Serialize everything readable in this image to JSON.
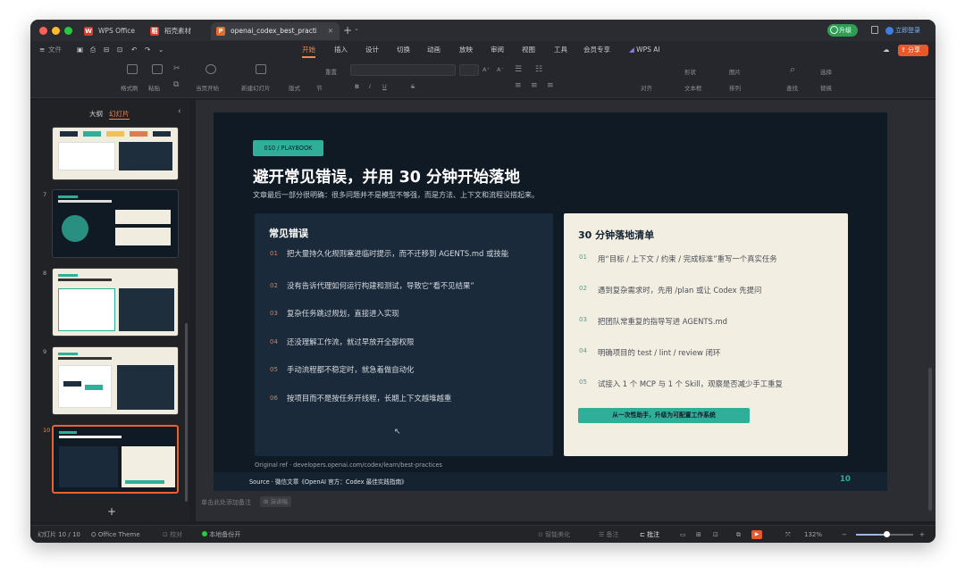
{
  "window": {
    "tabs": [
      {
        "label": "WPS Office",
        "icon": "wps-icon"
      },
      {
        "label": "稻壳素材",
        "icon": "docer-icon"
      },
      {
        "label": "openai_codex_best_practic",
        "icon": "ppt-file-icon"
      }
    ],
    "new_tab": "+",
    "upgrade_label": "升级",
    "login_label": "立即登录"
  },
  "menubar": {
    "file_label": "文件",
    "menus": [
      "开始",
      "插入",
      "设计",
      "切换",
      "动画",
      "放映",
      "审阅",
      "视图",
      "工具",
      "会员专享",
      "WPS AI"
    ],
    "active_menu": "开始",
    "share_label": "分享"
  },
  "toolbar": {
    "format_painter": "格式刷",
    "paste": "粘贴",
    "from_start": "当页开始",
    "new_slide": "新建幻灯片",
    "layout": "版式",
    "section": "节",
    "reset": "重置",
    "font_size_up": "A⁺",
    "font_size_down": "A⁻",
    "bold": "B",
    "italic": "I",
    "underline": "U",
    "strike": "S",
    "align": "对齐",
    "shape": "形状",
    "picture": "图片",
    "textbox": "文本框",
    "arrange": "排列",
    "find": "查找",
    "select": "选择",
    "replace": "替换"
  },
  "left_panel": {
    "tab_outline": "大纲",
    "tab_slides": "幻灯片",
    "slide_numbers": [
      "7",
      "8",
      "9",
      "10"
    ],
    "add_slide": "+"
  },
  "slide": {
    "tag": "010 / PLAYBOOK",
    "title": "避开常见错误，并用 30 分钟开始落地",
    "subtitle": "文章最后一部分很明确：很多问题并不是模型不够强，而是方法、上下文和流程没搭起来。",
    "errors_title": "常见错误",
    "errors": [
      {
        "num": "01",
        "text": "把大量持久化规则塞进临时提示，而不迁移到 AGENTS.md 或技能"
      },
      {
        "num": "02",
        "text": "没有告诉代理如何运行构建和测试，导致它“看不见结果”"
      },
      {
        "num": "03",
        "text": "复杂任务跳过规划，直接进入实现"
      },
      {
        "num": "04",
        "text": "还没理解工作流，就过早放开全部权限"
      },
      {
        "num": "05",
        "text": "手动流程都不稳定时，就急着做自动化"
      },
      {
        "num": "06",
        "text": "按项目而不是按任务开线程，长期上下文越堆越重"
      }
    ],
    "checklist_title": "30 分钟落地清单",
    "checklist": [
      {
        "num": "01",
        "text": "用“目标 / 上下文 / 约束 / 完成标准”重写一个真实任务"
      },
      {
        "num": "02",
        "text": "遇到复杂需求时，先用 /plan 或让 Codex 先提问"
      },
      {
        "num": "03",
        "text": "把团队常重复的指导写进 AGENTS.md"
      },
      {
        "num": "04",
        "text": "明确项目的 test / lint / review 闭环"
      },
      {
        "num": "05",
        "text": "试接入 1 个 MCP 与 1 个 Skill，观察是否减少手工重复"
      }
    ],
    "banner": "从一次性助手，升级为可配置工作系统",
    "original_ref": "Original ref · developers.openai.com/codex/learn/best-practices",
    "source": "Source · 微信文章《OpenAI 官方：Codex 最佳实践指南》",
    "page_number": "10"
  },
  "notes": {
    "placeholder": "单击此处添加备注",
    "chip": "演讲稿"
  },
  "statusbar": {
    "slide_info": "幻灯片 10 / 10",
    "theme": "Office Theme",
    "proofread": "校对",
    "backup": "本地备份开",
    "beautify": "智能美化",
    "notes": "备注",
    "comments": "批注",
    "zoom": "132%"
  },
  "colors": {
    "accent": "#e9622f",
    "teal": "#2fae99",
    "slide_bg": "#0f1a25",
    "card_dark": "#1a2a3a",
    "card_light": "#f2eee2"
  }
}
